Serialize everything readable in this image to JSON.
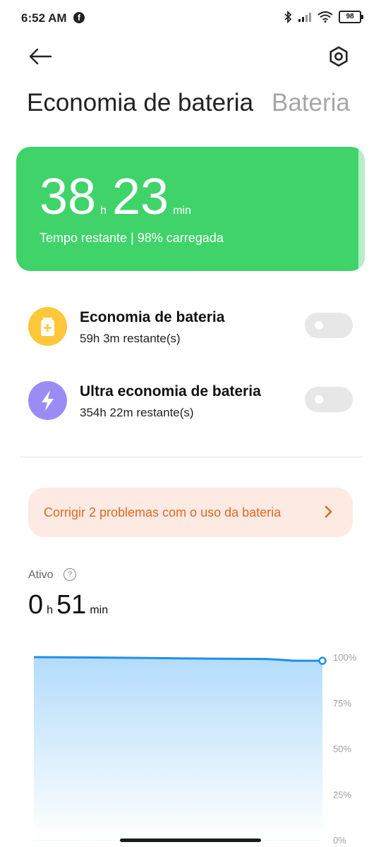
{
  "status_bar": {
    "time": "6:52 AM",
    "battery": "98"
  },
  "tabs": {
    "active": "Economia de bateria",
    "inactive": "Bateria"
  },
  "hero": {
    "hours": "38",
    "hours_unit": "h",
    "minutes": "23",
    "minutes_unit": "min",
    "subtitle": "Tempo restante | 98% carregada",
    "color": "#40d36a"
  },
  "modes": [
    {
      "title": "Economia de bateria",
      "subtitle": "59h 3m restante(s)",
      "icon": "battery-plus-icon",
      "color": "#ffc739",
      "enabled": false
    },
    {
      "title": "Ultra economia de bateria",
      "subtitle": "354h 22m restante(s)",
      "icon": "lightning-icon",
      "color": "#9b8cf5",
      "enabled": false
    }
  ],
  "fix_banner": {
    "text": "Corrigir 2 problemas com o uso da bateria",
    "color": "#e0671f"
  },
  "active": {
    "label": "Ativo",
    "hours": "0",
    "hours_unit": "h",
    "minutes": "51",
    "minutes_unit": "min"
  },
  "chart_data": {
    "type": "area",
    "yticks": [
      "100%",
      "75%",
      "50%",
      "25%",
      "0%"
    ],
    "ylim": [
      0,
      100
    ],
    "x": [
      0,
      0.2,
      0.4,
      0.6,
      0.8,
      0.85,
      0.9,
      1.0
    ],
    "values": [
      100,
      99.8,
      99.5,
      99.2,
      99.0,
      98.6,
      98.0,
      98.0
    ],
    "line_color": "#1e90e6",
    "fill_color_top": "#b3dcfb",
    "fill_color_bottom": "#ffffff"
  }
}
